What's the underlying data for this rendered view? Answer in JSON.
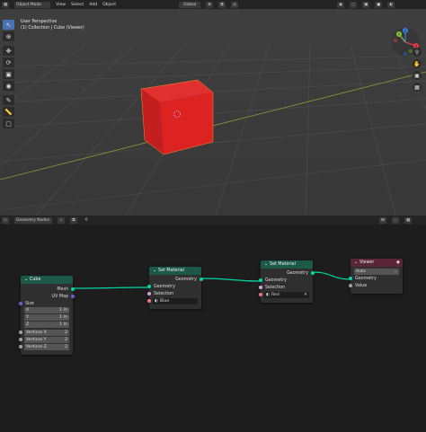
{
  "viewport_header": {
    "mode": "Object Mode",
    "menus": [
      "View",
      "Select",
      "Add",
      "Object"
    ],
    "orientation": "Global"
  },
  "viewport": {
    "perspective": "User Perspective",
    "collection_info": "(1) Collection | Cube (Viewer)",
    "cube_color": "#dd2222",
    "background_color": "#3d3d3d"
  },
  "gizmo": {
    "x": "X",
    "y": "Y",
    "z": "Z"
  },
  "node_editor_header": {
    "editor_name": "Geometry Nodes"
  },
  "nodes": {
    "cube": {
      "title": "Cube",
      "outputs": [
        "Mesh",
        "UV Map"
      ],
      "size_label": "Size",
      "size": [
        {
          "axis": "X",
          "value": "1 m"
        },
        {
          "axis": "Y",
          "value": "1 m"
        },
        {
          "axis": "Z",
          "value": "1 m"
        }
      ],
      "vertices": [
        {
          "label": "Vertices X",
          "value": "2"
        },
        {
          "label": "Vertices Y",
          "value": "2"
        },
        {
          "label": "Vertices Z",
          "value": "2"
        }
      ],
      "header_color": "#1c5a47"
    },
    "set_material_blue": {
      "title": "Set Material",
      "output": "Geometry",
      "inputs": [
        "Geometry",
        "Selection"
      ],
      "material": "Blue",
      "header_color": "#1c5a47"
    },
    "set_material_red": {
      "title": "Set Material",
      "output": "Geometry",
      "inputs": [
        "Geometry",
        "Selection"
      ],
      "material": "Red",
      "header_color": "#1c5a47"
    },
    "viewer": {
      "title": "Viewer",
      "domain": "Auto",
      "inputs": [
        "Geometry",
        "Value"
      ],
      "header_color": "#5a2536"
    }
  }
}
